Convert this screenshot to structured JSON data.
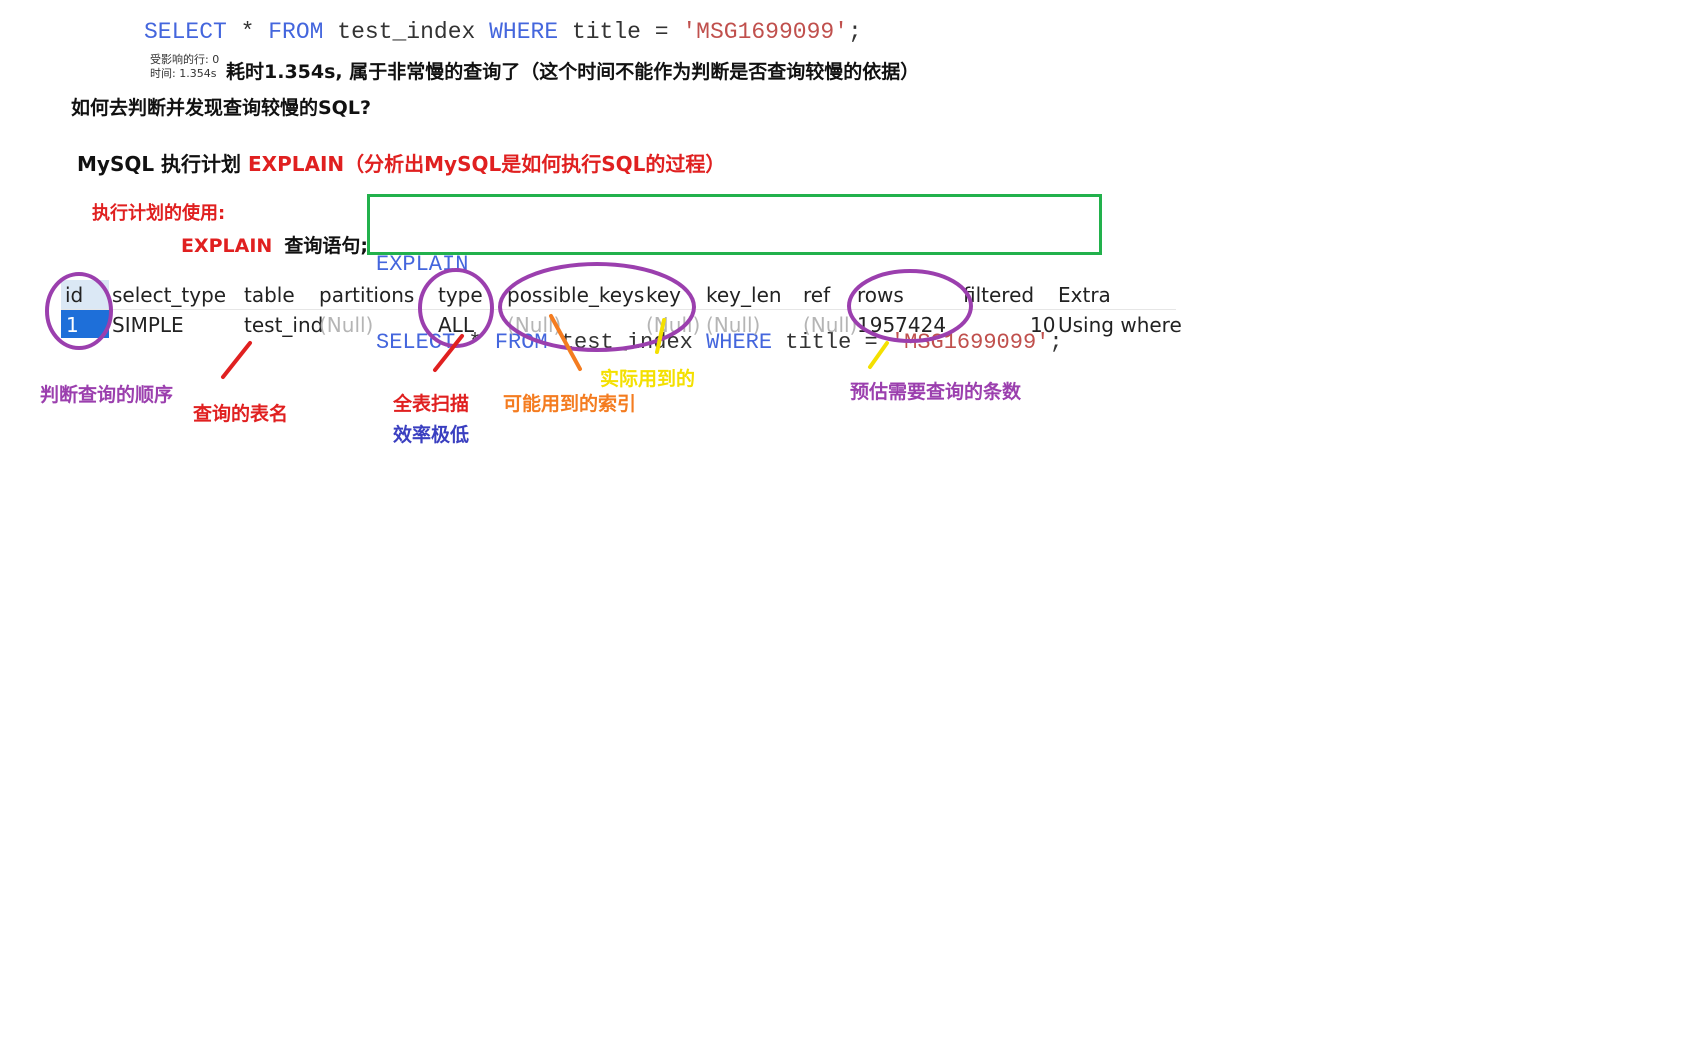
{
  "top_query": {
    "kw_select": "SELECT",
    "star": " * ",
    "kw_from": "FROM",
    "table": " test_index ",
    "kw_where": "WHERE",
    "cond": " title = ",
    "value": "'MSG1699099'",
    "semicolon": ";"
  },
  "affected": {
    "line1": "受影响的行: 0",
    "line2": "时间: 1.354s"
  },
  "timing_note": "耗时1.354s, 属于非常慢的查询了（这个时间不能作为判断是否查询较慢的依据）",
  "question": "如何去判断并发现查询较慢的SQL?",
  "plan_title": {
    "prefix": "MySQL 执行计划 ",
    "explain": "EXPLAIN（分析出MySQL是如何执行SQL的过程）"
  },
  "usage_label": "执行计划的使用:",
  "explain_syntax": {
    "kw": "EXPLAIN",
    "rest": "查询语句;"
  },
  "boxed_query": {
    "line1": "EXPLAIN",
    "kw_select": "SELECT",
    "star": " * ",
    "kw_from": "FROM",
    "table": " test_index ",
    "kw_where": "WHERE",
    "cond": " title = ",
    "value": "'MSG1699099'",
    "semicolon": ";"
  },
  "result_table": {
    "headers": [
      "id",
      "select_type",
      "table",
      "partitions",
      "type",
      "possible_keys",
      "key",
      "key_len",
      "ref",
      "rows",
      "filtered",
      "Extra"
    ],
    "row": [
      "1",
      "SIMPLE",
      "test_ind",
      "(Null)",
      "ALL",
      "(Null)",
      "(Null)",
      "(Null)",
      "(Null)",
      "1957424",
      "10",
      "Using where"
    ]
  },
  "annotations": {
    "id": "判断查询的顺序",
    "table": "查询的表名",
    "type_1": "全表扫描",
    "type_2": "效率极低",
    "possible_keys": "可能用到的索引",
    "key": "实际用到的",
    "rows": "预估需要查询的条数"
  },
  "colors": {
    "keyword": "#4466dd",
    "string": "#c0504d",
    "red": "#e02020",
    "purple": "#9b3fae",
    "orange": "#f47c20",
    "yellow": "#f4e000",
    "blue_note": "#3a3fc0",
    "green_box": "#22b14c",
    "selection": "#1e6fd9"
  }
}
